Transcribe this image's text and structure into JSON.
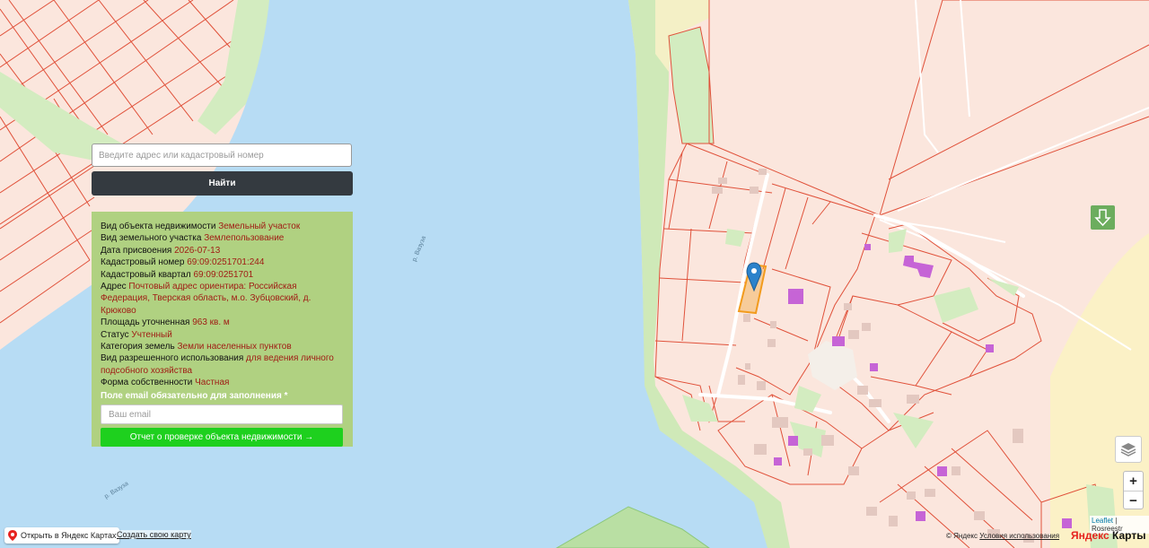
{
  "search": {
    "placeholder": "Введите адрес или кадастровый номер",
    "button_label": "Найти"
  },
  "info": {
    "rows": [
      {
        "label": "Вид объекта недвижимости",
        "value": "Земельный участок"
      },
      {
        "label": "Вид земельного участка",
        "value": "Землепользование"
      },
      {
        "label": "Дата присвоения",
        "value": "2026-07-13"
      },
      {
        "label": "Кадастровый номер",
        "value": "69:09:0251701:244"
      },
      {
        "label": "Кадастровый квартал",
        "value": "69:09:0251701"
      },
      {
        "label": "Адрес",
        "value": "Почтовый адрес ориентира: Российская Федерация, Тверская область, м.о. Зубцовский, д. Крюково"
      },
      {
        "label": "Площадь уточненная",
        "value": "963 кв. м"
      },
      {
        "label": "Статус",
        "value": "Учтенный"
      },
      {
        "label": "Категория земель",
        "value": "Земли населенных пунктов"
      },
      {
        "label": "Вид разрешенного использования",
        "value": "для ведения личного подсобного хозяйства"
      },
      {
        "label": "Форма собственности",
        "value": "Частная"
      }
    ],
    "email_label": "Поле email обязательно для заполнения *",
    "email_placeholder": "Ваш email",
    "report_button_label": "Отчет о проверке объекта недвижимости →"
  },
  "map": {
    "river_labels": [
      "р. Вазуза",
      "р. Вазуза"
    ],
    "colors": {
      "land": "#fbe6dd",
      "water": "#b7dcf4",
      "greenery": "#d3ecc0",
      "parcel_border": "#e0513a",
      "selected_parcel": "#f29b1d",
      "building": "#e3c8c0",
      "highlight_building": "#c664d6",
      "marker": "#2b82cb"
    }
  },
  "controls": {
    "zoom_in": "+",
    "zoom_out": "−",
    "attribution_leaflet": "Leaflet",
    "attribution_source": "Rosreestr",
    "open_yandex_label": "Открыть в Яндекс Картах",
    "create_map_label": "Создать свою карту",
    "copyright_label": "© Яндекс",
    "terms_label": "Условия использования",
    "logo_part1": "Яндекс",
    "logo_part2": "Карты"
  }
}
